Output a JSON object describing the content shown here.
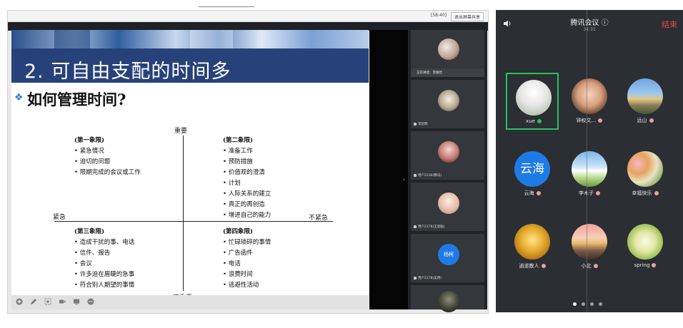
{
  "desktop": {
    "titlebar_info": "[58:40]",
    "titlebar_button": "退出屏幕共享",
    "slide": {
      "title": "2. 可自由支配的时间多",
      "subhead_bullet": "❖",
      "subhead": "如何管理时间?",
      "axis_top": "重要",
      "axis_bottom": "不重要",
      "axis_left": "紧急",
      "axis_right": "不紧急",
      "q1": {
        "title": "(第一象限)",
        "items": [
          "• 紧急情况",
          "• 迫切的问题",
          "• 限期完成的会议或工作"
        ]
      },
      "q2": {
        "title": "(第二象限)",
        "items": [
          "• 准备工作",
          "• 预防措施",
          "• 价值观的澄清",
          "• 计划",
          "• 人际关系的建立",
          "• 真正的再创造",
          "• 增进自己的能力"
        ]
      },
      "q3": {
        "title": "(第三象限)",
        "items": [
          "• 造成干扰的事、电话",
          "• 信件、报告",
          "• 会议",
          "• 许多迫在眉睫的急事",
          "• 符合别人期望的事情"
        ]
      },
      "q4": {
        "title": "(第四象限)",
        "items": [
          "• 忙碌琐碎的事情",
          "• 广告函件",
          "• 电话",
          "• 浪费时间",
          "• 逃避性活动"
        ]
      }
    },
    "participants": {
      "active_label": "正在讲话：李维佳",
      "thumbs": [
        {
          "label": "李思明"
        },
        {
          "label": "用户2130(腾讯)"
        },
        {
          "label": "用户2178(王思聪)"
        },
        {
          "label": "杨柯",
          "initials": "杨柯"
        },
        {
          "label": "用户2178(吴用)"
        }
      ]
    }
  },
  "phone": {
    "title": "腾讯会议 ⓘ",
    "time": "34:31",
    "end_label": "结束",
    "participants": [
      {
        "name": "xue",
        "selected": true
      },
      {
        "name": "钟权文..."
      },
      {
        "name": "远山"
      },
      {
        "name": "云海",
        "initials": "云海"
      },
      {
        "name": "李木子"
      },
      {
        "name": "幸福快乐"
      },
      {
        "name": "逍遥散人"
      },
      {
        "name": "小北"
      },
      {
        "name": "spring"
      }
    ]
  },
  "colors": {
    "slide_title_bg": "#27427a",
    "end_red": "#e24b3b",
    "selected_green": "#25c25f",
    "avatar_blue": "#1e7be6"
  }
}
